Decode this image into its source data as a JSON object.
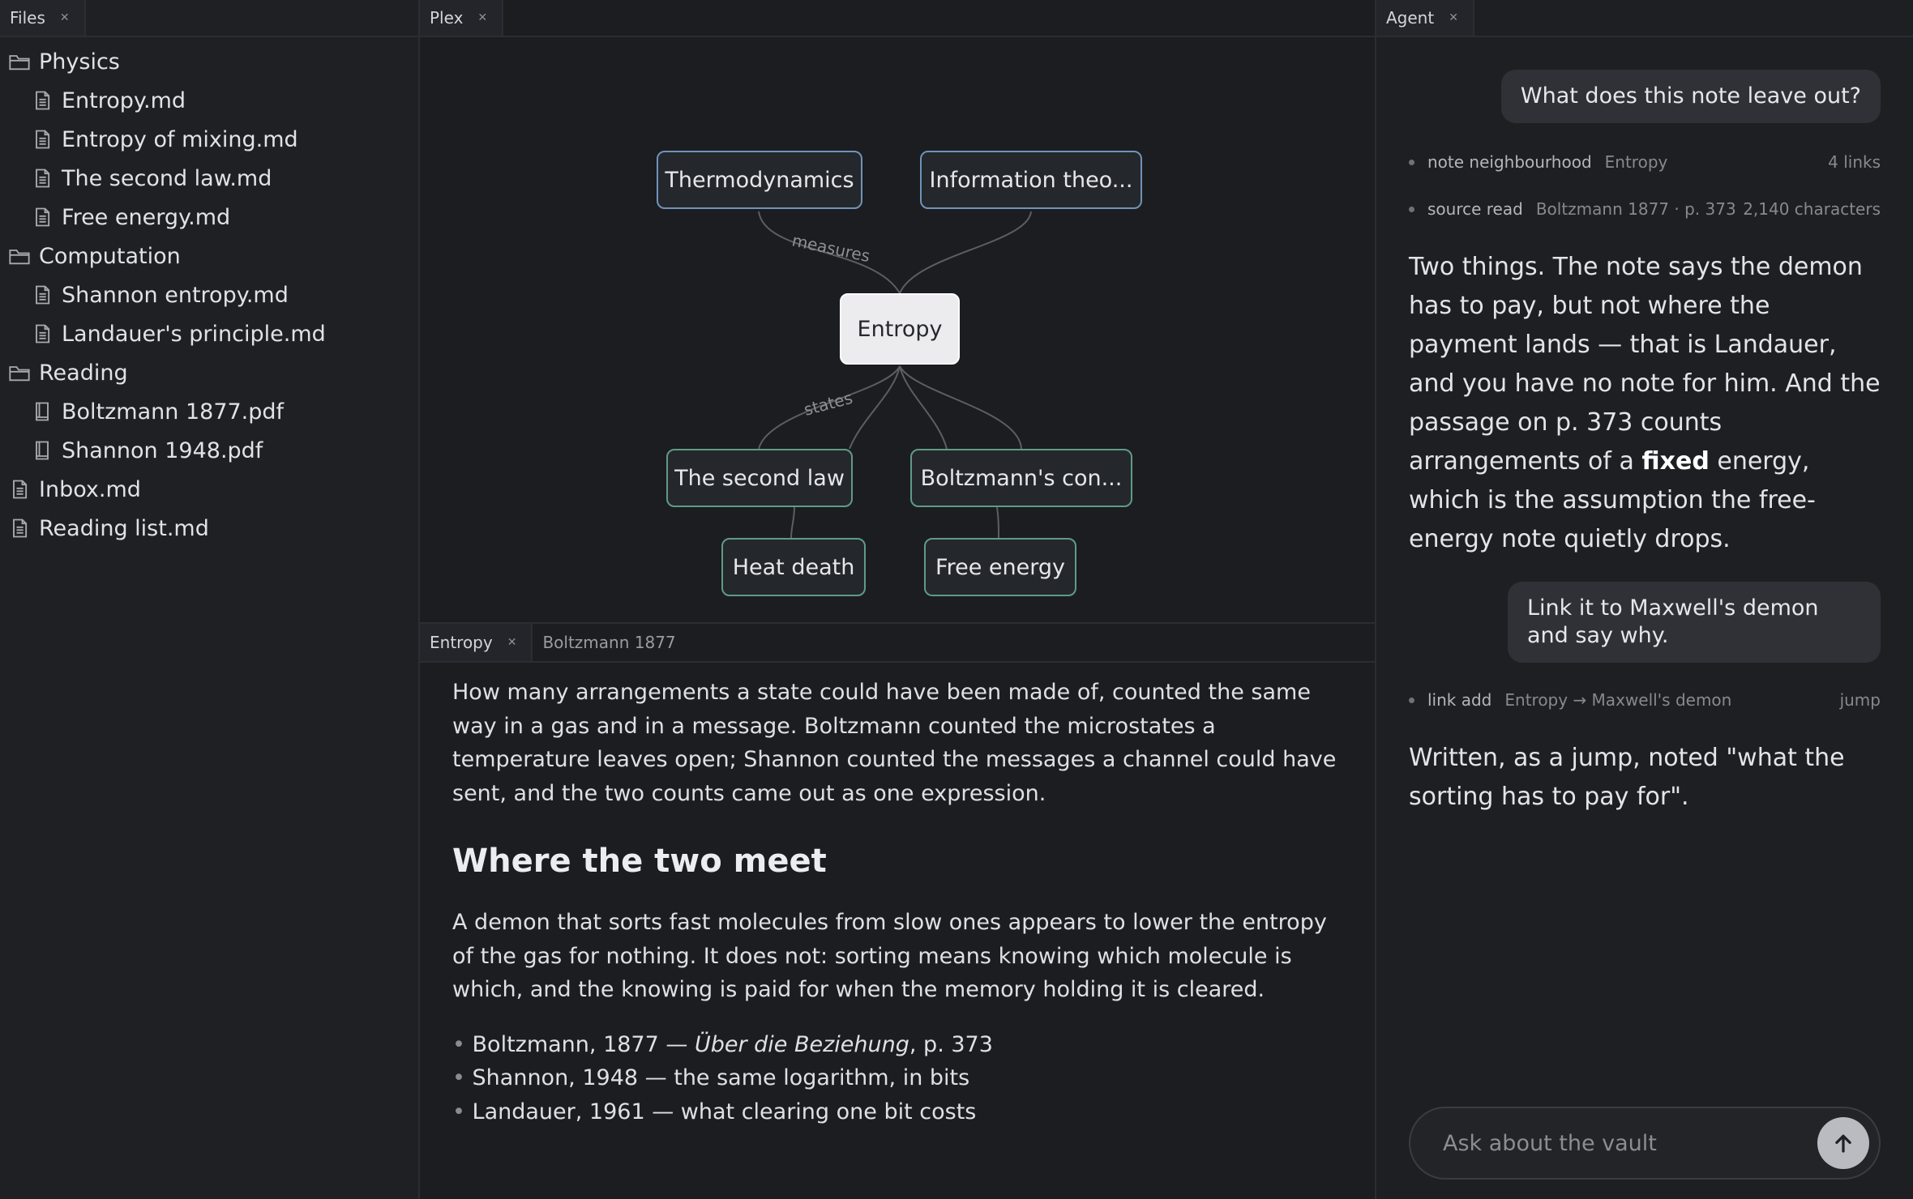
{
  "files_panel": {
    "tab_label": "Files",
    "tree": [
      {
        "label": "Physics",
        "kind": "folder",
        "level": 0
      },
      {
        "label": "Entropy.md",
        "kind": "file",
        "level": 1
      },
      {
        "label": "Entropy of mixing.md",
        "kind": "file",
        "level": 1
      },
      {
        "label": "The second law.md",
        "kind": "file",
        "level": 1
      },
      {
        "label": "Free energy.md",
        "kind": "file",
        "level": 1
      },
      {
        "label": "Computation",
        "kind": "folder",
        "level": 0
      },
      {
        "label": "Shannon entropy.md",
        "kind": "file",
        "level": 1
      },
      {
        "label": "Landauer's principle.md",
        "kind": "file",
        "level": 1
      },
      {
        "label": "Reading",
        "kind": "folder",
        "level": 0
      },
      {
        "label": "Boltzmann 1877.pdf",
        "kind": "book",
        "level": 1
      },
      {
        "label": "Shannon 1948.pdf",
        "kind": "book",
        "level": 1
      },
      {
        "label": "Inbox.md",
        "kind": "file",
        "level": 0
      },
      {
        "label": "Reading list.md",
        "kind": "file",
        "level": 0
      }
    ]
  },
  "graph_panel": {
    "tab_label": "Plex",
    "nodes": {
      "thermodynamics": "Thermodynamics",
      "information_theory": "Information theo...",
      "entropy": "Entropy",
      "second_law": "The second law",
      "boltzmann": "Boltzmann's con...",
      "heat_death": "Heat death",
      "free_energy": "Free energy"
    },
    "edge_labels": {
      "measures": "measures",
      "states": "states"
    }
  },
  "editor": {
    "tabs": [
      {
        "label": "Entropy",
        "active": true
      },
      {
        "label": "Boltzmann 1877",
        "active": false
      }
    ],
    "intro": "How many arrangements a state could have been made of, counted the same way in a gas and in a message. Boltzmann counted the microstates a temperature leaves open; Shannon counted the messages a channel could have sent, and the two counts came out as one expression.",
    "heading": "Where the two meet",
    "paragraph": "A demon that sorts fast molecules from slow ones appears to lower the entropy of the gas for nothing. It does not: sorting means knowing which molecule is which, and the knowing is paid for when the memory holding it is cleared.",
    "refs": [
      {
        "pre": "Boltzmann, 1877 — ",
        "italic": "Über die Beziehung",
        "post": ", p. 373"
      },
      {
        "pre": "Shannon, 1948 — the same logarithm, in bits",
        "italic": "",
        "post": ""
      },
      {
        "pre": "Landauer, 1961 — what clearing one bit costs",
        "italic": "",
        "post": ""
      }
    ]
  },
  "agent_panel": {
    "tab_label": "Agent",
    "user_message_1": "What does this note leave out?",
    "tool_calls_1": [
      {
        "name": "note neighbourhood",
        "arg": "Entropy",
        "result": "4 links"
      },
      {
        "name": "source read",
        "arg": "Boltzmann 1877 · p. 373",
        "result": "2,140 characters"
      }
    ],
    "answer_1_before": "Two things. The note says the demon has to pay, but not where the payment lands — that is Landauer, and you have no note for him. And the passage on p. 373 counts arrangements of a ",
    "answer_1_bold": "fixed",
    "answer_1_after": " energy, which is the assumption the free-energy note quietly drops.",
    "user_message_2": "Link it to Maxwell's demon and say why.",
    "tool_calls_2": [
      {
        "name": "link add",
        "arg": "Entropy → Maxwell's demon",
        "result": "jump"
      }
    ],
    "answer_2": "Written, as a jump, noted \"what the sorting has to pay for\".",
    "composer_placeholder": "Ask about the vault"
  }
}
